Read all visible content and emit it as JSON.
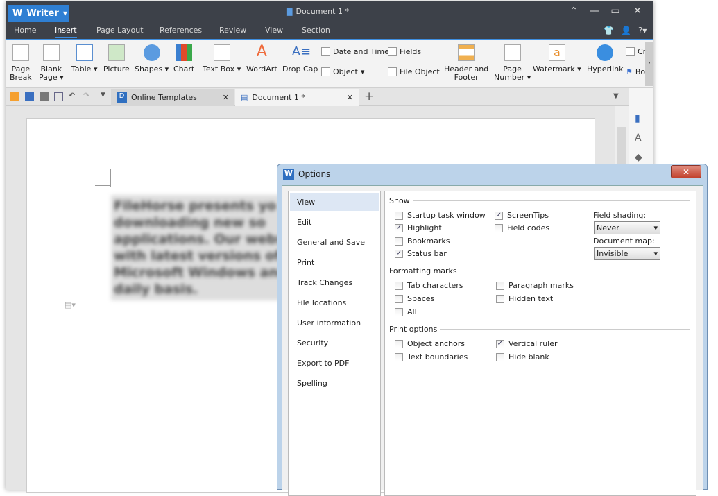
{
  "app": {
    "name": "Writer",
    "doc_title": "Document 1 *"
  },
  "menu_tabs": [
    "Home",
    "Insert",
    "Page Layout",
    "References",
    "Review",
    "View",
    "Section"
  ],
  "active_tab": "Insert",
  "ribbon": {
    "page_break": [
      "Page",
      "Break"
    ],
    "blank_page": [
      "Blank",
      "Page"
    ],
    "table": "Table",
    "picture": "Picture",
    "shapes": "Shapes",
    "chart": "Chart",
    "text_box": "Text Box",
    "wordart": "WordArt",
    "drop_cap": "Drop Cap",
    "date_time": "Date and Time",
    "object": "Object",
    "fields": "Fields",
    "file_object": "File Object",
    "header_footer": [
      "Header and",
      "Footer"
    ],
    "page_number": [
      "Page",
      "Number"
    ],
    "watermark": "Watermark",
    "hyperlink": "Hyperlink",
    "cross_ref": "Cr",
    "bookmark": "Bo"
  },
  "doc_tabs": [
    "Online Templates",
    "Document 1 *"
  ],
  "document_text": "FileHorse presents yo downloading new so applications. Our webs with latest versions of Microsoft Windows and daily basis.",
  "dialog": {
    "title": "Options",
    "nav": [
      "View",
      "Edit",
      "General and Save",
      "Print",
      "Track Changes",
      "File locations",
      "User information",
      "Security",
      "Export to PDF",
      "Spelling"
    ],
    "selected": "View",
    "groups": {
      "show": "Show",
      "formatting": "Formatting marks",
      "print": "Print options"
    },
    "show": [
      {
        "label": "Startup task window",
        "checked": false
      },
      {
        "label": "Highlight",
        "checked": true
      },
      {
        "label": "Bookmarks",
        "checked": false
      },
      {
        "label": "Status bar",
        "checked": true
      },
      {
        "label": "ScreenTips",
        "checked": true
      },
      {
        "label": "Field codes",
        "checked": false
      }
    ],
    "field_shading": {
      "label": "Field shading:",
      "value": "Never"
    },
    "document_map": {
      "label": "Document map:",
      "value": "Invisible"
    },
    "formatting": [
      {
        "label": "Tab characters",
        "checked": false
      },
      {
        "label": "Spaces",
        "checked": false
      },
      {
        "label": "All",
        "checked": false
      },
      {
        "label": "Paragraph marks",
        "checked": false
      },
      {
        "label": "Hidden text",
        "checked": false
      }
    ],
    "print": [
      {
        "label": "Object anchors",
        "checked": false
      },
      {
        "label": "Text boundaries",
        "checked": false
      },
      {
        "label": "Vertical ruler",
        "checked": true
      },
      {
        "label": "Hide blank",
        "checked": false
      }
    ]
  }
}
